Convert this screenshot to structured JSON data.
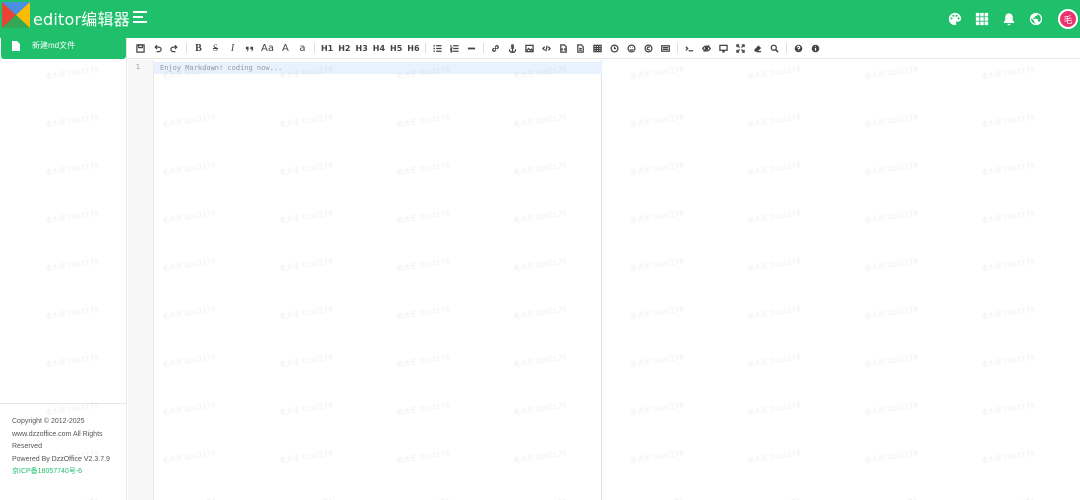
{
  "header": {
    "app_title": "editor编辑器",
    "avatar_text": "毛",
    "colors": {
      "brand": "#1fbf6c",
      "avatar": "#e8336d"
    },
    "icons": [
      "palette-icon",
      "apps-grid-icon",
      "bell-icon",
      "globe-icon"
    ]
  },
  "sidebar": {
    "new_file_label": "新建md文件",
    "footer": {
      "copyright": "Copyright © 2012-2025",
      "site": "www.dzzoffice.com All Rights",
      "reserved": "Reserved",
      "powered": "Powered By DzzOffice V2.3.7.9",
      "icp": "京ICP备18057740号-6"
    }
  },
  "toolbar": {
    "bold": "B",
    "strike": "S",
    "italic": "I",
    "font_size": "Aa",
    "upper": "A",
    "lower": "a",
    "headings": [
      "H1",
      "H2",
      "H3",
      "H4",
      "H5",
      "H6"
    ]
  },
  "editor": {
    "line_number": "1",
    "placeholder_text": "Enjoy Markdown! coding now..."
  },
  "watermark": {
    "text": "毛大生 Dzz2174"
  }
}
